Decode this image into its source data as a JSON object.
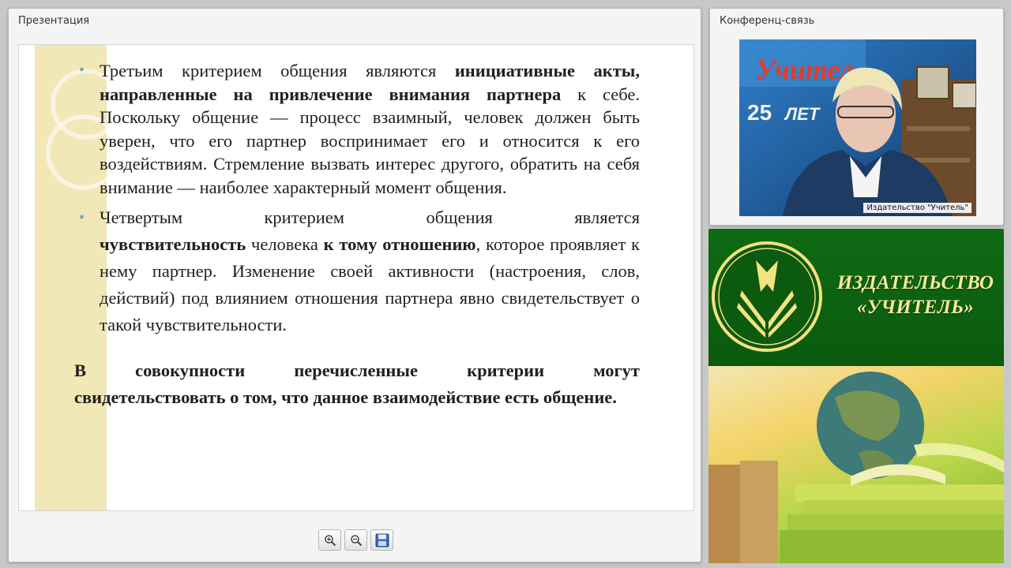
{
  "presentation": {
    "title": "Презентация",
    "slide": {
      "b1_plain1": "Третьим критерием общения являются ",
      "b1_bold": "инициативные акты, направленные на привлечение внимания партнера",
      "b1_plain2": " к себе. Поскольку общение — процесс взаимный, человек должен быть уверен, что его партнер воспринимает его и относится к его воздействиям. Стремление вызвать интерес другого, обратить на себя внимание — наиболее характерный момент общения.",
      "b2_row1": "Четвертым критерием общения является",
      "b2_bold1": "чувствительность",
      "b2_plain1": " человека ",
      "b2_bold2": "к тому отношению",
      "b2_plain2": ", которое проявляет к нему партнер. Изменение своей активности (настроения, слов, действий) под влиянием отношения партнера явно свидетельствует о такой чувствительности.",
      "c_row1": "В совокупности перечисленные критерии могут",
      "c_rest": "свидетельствовать о том, что данное взаимодействие есть общение."
    },
    "toolbar": {
      "zoom_in_icon": "zoom-in-icon",
      "zoom_out_icon": "zoom-out-icon",
      "save_icon": "floppy-disk-icon"
    }
  },
  "conference": {
    "title": "Конференц-связь",
    "video_label": "Издательство \"Учитель\""
  },
  "banner": {
    "line1": "ИЗДАТЕЛЬСТВО",
    "line2": "«УЧИТЕЛЬ»"
  },
  "colors": {
    "banner_green": "#0d6211",
    "logo_gold": "#f6e99a",
    "bullet": "#6fa9b6",
    "slide_stripe": "#f1e7b7"
  }
}
